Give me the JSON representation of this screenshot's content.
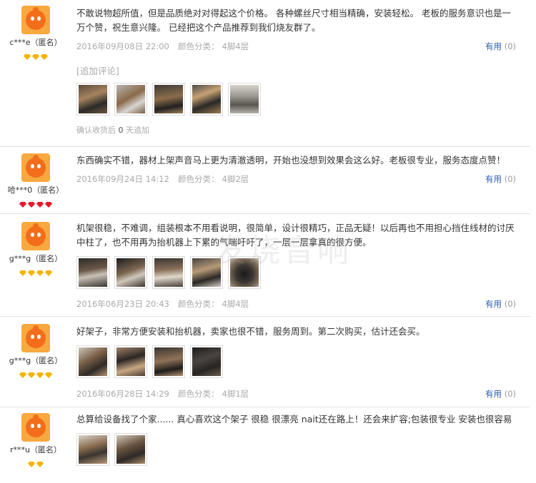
{
  "reviews": [
    {
      "user": "c***e（匿名）",
      "badge_type": "gold",
      "badge_count": 3,
      "text": "不敢说物超所值，但是品质绝对对得起这个价格。 各种螺丝尺寸相当精确，安装轻松。 老板的服务意识也是一万个赞，祝生意兴隆。 已经把这个产品推荐到我们烧友群了。",
      "date": "2016年09月08日 22:00",
      "spec_label": "颜色分类：",
      "spec_value": "4脚4层",
      "useful_label": "有用",
      "useful_count": "(0)",
      "append_label": "[追加评论]",
      "confirm_text_a": "确认收货后",
      "confirm_days": "0",
      "confirm_text_b": "天追加",
      "pics": [
        "photo-rack-1",
        "photo-rack-2",
        "photo-rack-3",
        "photo-rack-4",
        "photo-rack-5"
      ]
    },
    {
      "user": "哈***0（匿名）",
      "badge_type": "red",
      "badge_count": 4,
      "text": "东西确实不错，器材上架声音马上更为清澈透明，开始也没想到效果会这么好。老板很专业，服务态度点赞！",
      "date": "2016年09月24日 14:12",
      "spec_label": "颜色分类：",
      "spec_value": "4脚2层",
      "useful_label": "有用",
      "useful_count": "(0)"
    },
    {
      "user": "g***g（匿名）",
      "badge_type": "gold",
      "badge_count": 4,
      "text": "机架很稳，不难调，组装根本不用看说明，很简单，设计很精巧，正品无疑！以后再也不用担心挡住线材的讨厌中柱了，也不用再为抬机器上下累的气喘吁吁了，一层一层拿真的很方便。",
      "date": "2016年06月23日 20:43",
      "spec_label": "颜色分类：",
      "spec_value": "4脚4层",
      "useful_label": "有用",
      "useful_count": "(0)",
      "pics": [
        "photo-rack-6",
        "photo-rack-7",
        "photo-rack-8",
        "photo-rack-9",
        "photo-rack-10"
      ]
    },
    {
      "user": "g***g（匿名）",
      "badge_type": "gold",
      "badge_count": 4,
      "text": "好架子，非常方便安装和抬机器，卖家也很不错，服务周到。第二次购买，估计还会买。",
      "date": "2016年06月28日 14:29",
      "spec_label": "颜色分类：",
      "spec_value": "4脚1层",
      "useful_label": "有用",
      "useful_count": "(0)",
      "pics": [
        "photo-rack-11",
        "photo-rack-12",
        "photo-rack-13",
        "photo-rack-14"
      ]
    },
    {
      "user": "r***u（匿名）",
      "badge_type": "gold",
      "badge_count": 2,
      "text": "总算给设备找了个家...... 真心喜欢这个架子 很稳 很漂亮 nait还在路上！还会来扩容;包装很专业 安装也很容易",
      "pics": [
        "photo-rack-15",
        "photo-rack-16"
      ]
    }
  ],
  "watermark": "发烧音响",
  "colors": {
    "link": "#2a5db0",
    "meta": "#aaaaaa",
    "divider": "#e4e4e4",
    "badge_gold": "#f4b400",
    "badge_red": "#e8192c",
    "avatar_bg": "#f7a83e"
  }
}
